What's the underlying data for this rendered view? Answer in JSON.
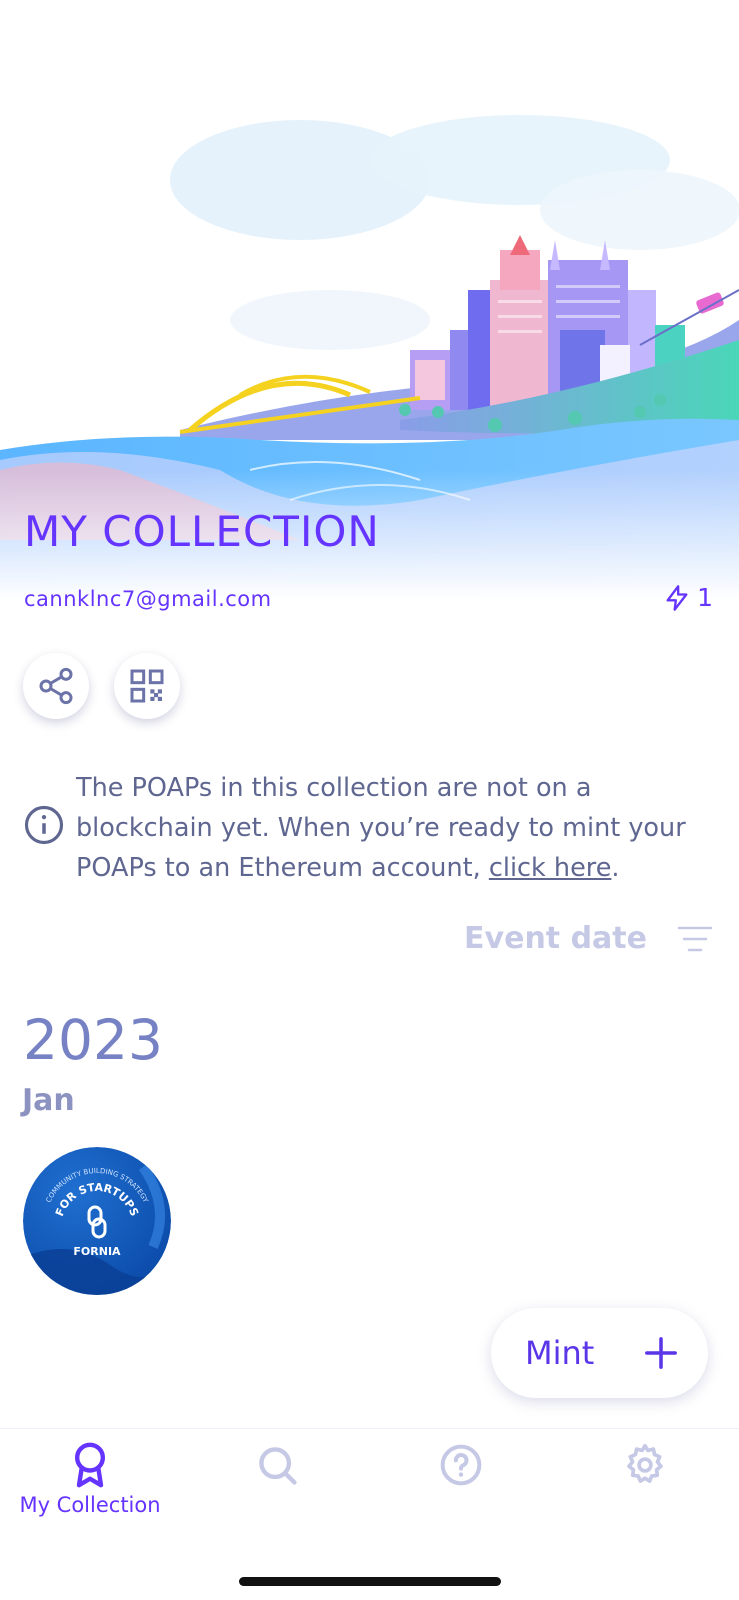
{
  "header": {
    "title": "MY COLLECTION",
    "email": "cannklnc7@gmail.com",
    "power_count": "1"
  },
  "actions": {
    "share_icon": "share-icon",
    "qr_icon": "qr-code-icon"
  },
  "info": {
    "text_before": "The POAPs in this collection are not on a blockchain yet. When you’re ready to mint your POAPs to an Ethereum account, ",
    "link": "click here",
    "text_after": "."
  },
  "sort": {
    "label": "Event date",
    "icon": "filter-lines-icon"
  },
  "collection": {
    "year": "2023",
    "month": "Jan",
    "badges": [
      {
        "top_text": "COMMUNITY BUILDING STRATEGY",
        "main_text": "FOR STARTUPS",
        "bottom_text": "FORNIA"
      }
    ]
  },
  "mint": {
    "label": "Mint"
  },
  "tabbar": {
    "items": [
      {
        "label": "My Collection",
        "icon": "ribbon-award-icon",
        "active": true
      },
      {
        "label": "",
        "icon": "search-icon"
      },
      {
        "label": "",
        "icon": "help-circle-icon"
      },
      {
        "label": "",
        "icon": "gear-icon"
      }
    ]
  },
  "colors": {
    "accent": "#6534ff",
    "muted_text": "#5f6791",
    "year_text": "#7782c4",
    "inactive_icon": "#c6c9e5"
  }
}
